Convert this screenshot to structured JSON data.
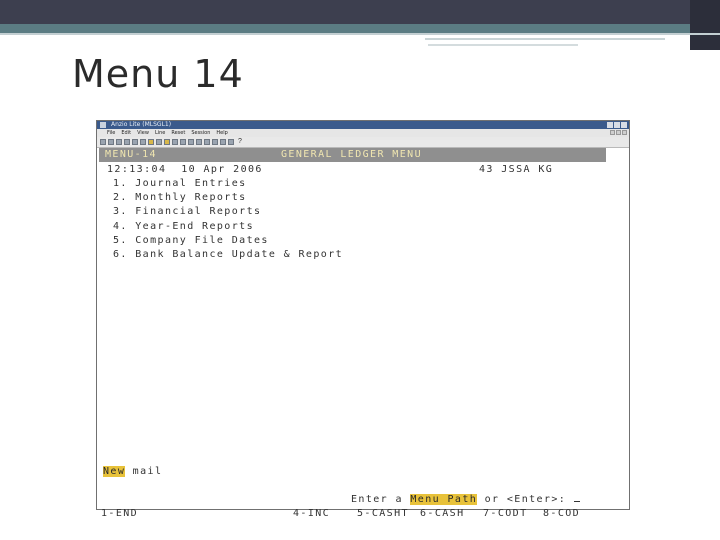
{
  "slide": {
    "title": "Menu 14"
  },
  "window": {
    "title": "Anzio Lite (MLSGL1)",
    "menu_items": [
      "File",
      "Edit",
      "View",
      "Line",
      "Reset",
      "Session",
      "Help"
    ]
  },
  "terminal": {
    "header_left": "MENU-14",
    "header_center": "GENERAL LEDGER MENU",
    "datetime": "12:13:04  10 Apr 2006",
    "company": "43 JSSA KG",
    "menu_items": [
      "1. Journal Entries",
      "2. Monthly Reports",
      "3. Financial Reports",
      "4. Year-End Reports",
      "5. Company File Dates",
      "6. Bank Balance Update & Report"
    ],
    "prompt_highlight": "New",
    "prompt_rest": " mail",
    "enter_prefix": "Enter a ",
    "enter_highlight": "Menu Path",
    "enter_suffix": " or <Enter>: ",
    "fkeys": [
      {
        "label": "1-END"
      },
      {
        "label": "4-INC"
      },
      {
        "label": "5-CASHT"
      },
      {
        "label": "6-CASH"
      },
      {
        "label": "7-CODT"
      },
      {
        "label": "8-COD"
      }
    ]
  },
  "colors": {
    "header_bar": "#8f8f8f",
    "highlight": "#e8c23a",
    "slide_band": "#3d3f4f",
    "slide_teal": "#5b7c83"
  }
}
